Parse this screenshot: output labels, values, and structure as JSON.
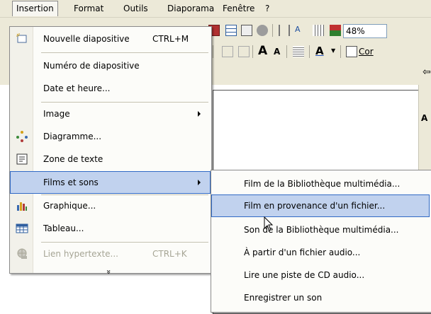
{
  "menubar": {
    "items": [
      "Insertion",
      "Format",
      "Outils",
      "Diaporama",
      "Fenêtre",
      "?"
    ]
  },
  "toolbar": {
    "zoom_value": "48%",
    "cor_partial": "Cor",
    "format_A_large": "A",
    "format_A_small": "A",
    "font_color_A": "A",
    "right_partial_label": "A"
  },
  "insert_menu": {
    "items": [
      {
        "label": "Nouvelle diapositive",
        "shortcut": "CTRL+M",
        "icon": "new-slide-icon"
      },
      {
        "label": "Numéro de diapositive"
      },
      {
        "label": "Date et heure..."
      },
      {
        "label": "Image",
        "submenu": true
      },
      {
        "label": "Diagramme...",
        "icon": "diagram-icon"
      },
      {
        "label": "Zone de texte",
        "icon": "text-box-icon"
      },
      {
        "label": "Films et sons",
        "submenu": true,
        "highlighted": true
      },
      {
        "label": "Graphique...",
        "icon": "chart-icon"
      },
      {
        "label": "Tableau...",
        "icon": "table-icon"
      },
      {
        "label": "Lien hypertexte...",
        "shortcut": "CTRL+K",
        "disabled": true,
        "icon": "hyperlink-globe-icon"
      }
    ],
    "expand_glyph": "»"
  },
  "films_sons_submenu": {
    "items": [
      {
        "label": "Film de la Bibliothèque multimédia..."
      },
      {
        "label": "Film en provenance d'un fichier...",
        "highlighted": true
      },
      {
        "label": "Son de la Bibliothèque multimédia..."
      },
      {
        "label": "À partir d'un fichier audio..."
      },
      {
        "label": "Lire une piste de CD audio..."
      },
      {
        "label": "Enregistrer un son"
      }
    ]
  },
  "colors": {
    "chrome": "#ece9d8",
    "highlight_fill": "#c1d2ee",
    "highlight_border": "#316ac5",
    "disabled_text": "#a6a595"
  }
}
